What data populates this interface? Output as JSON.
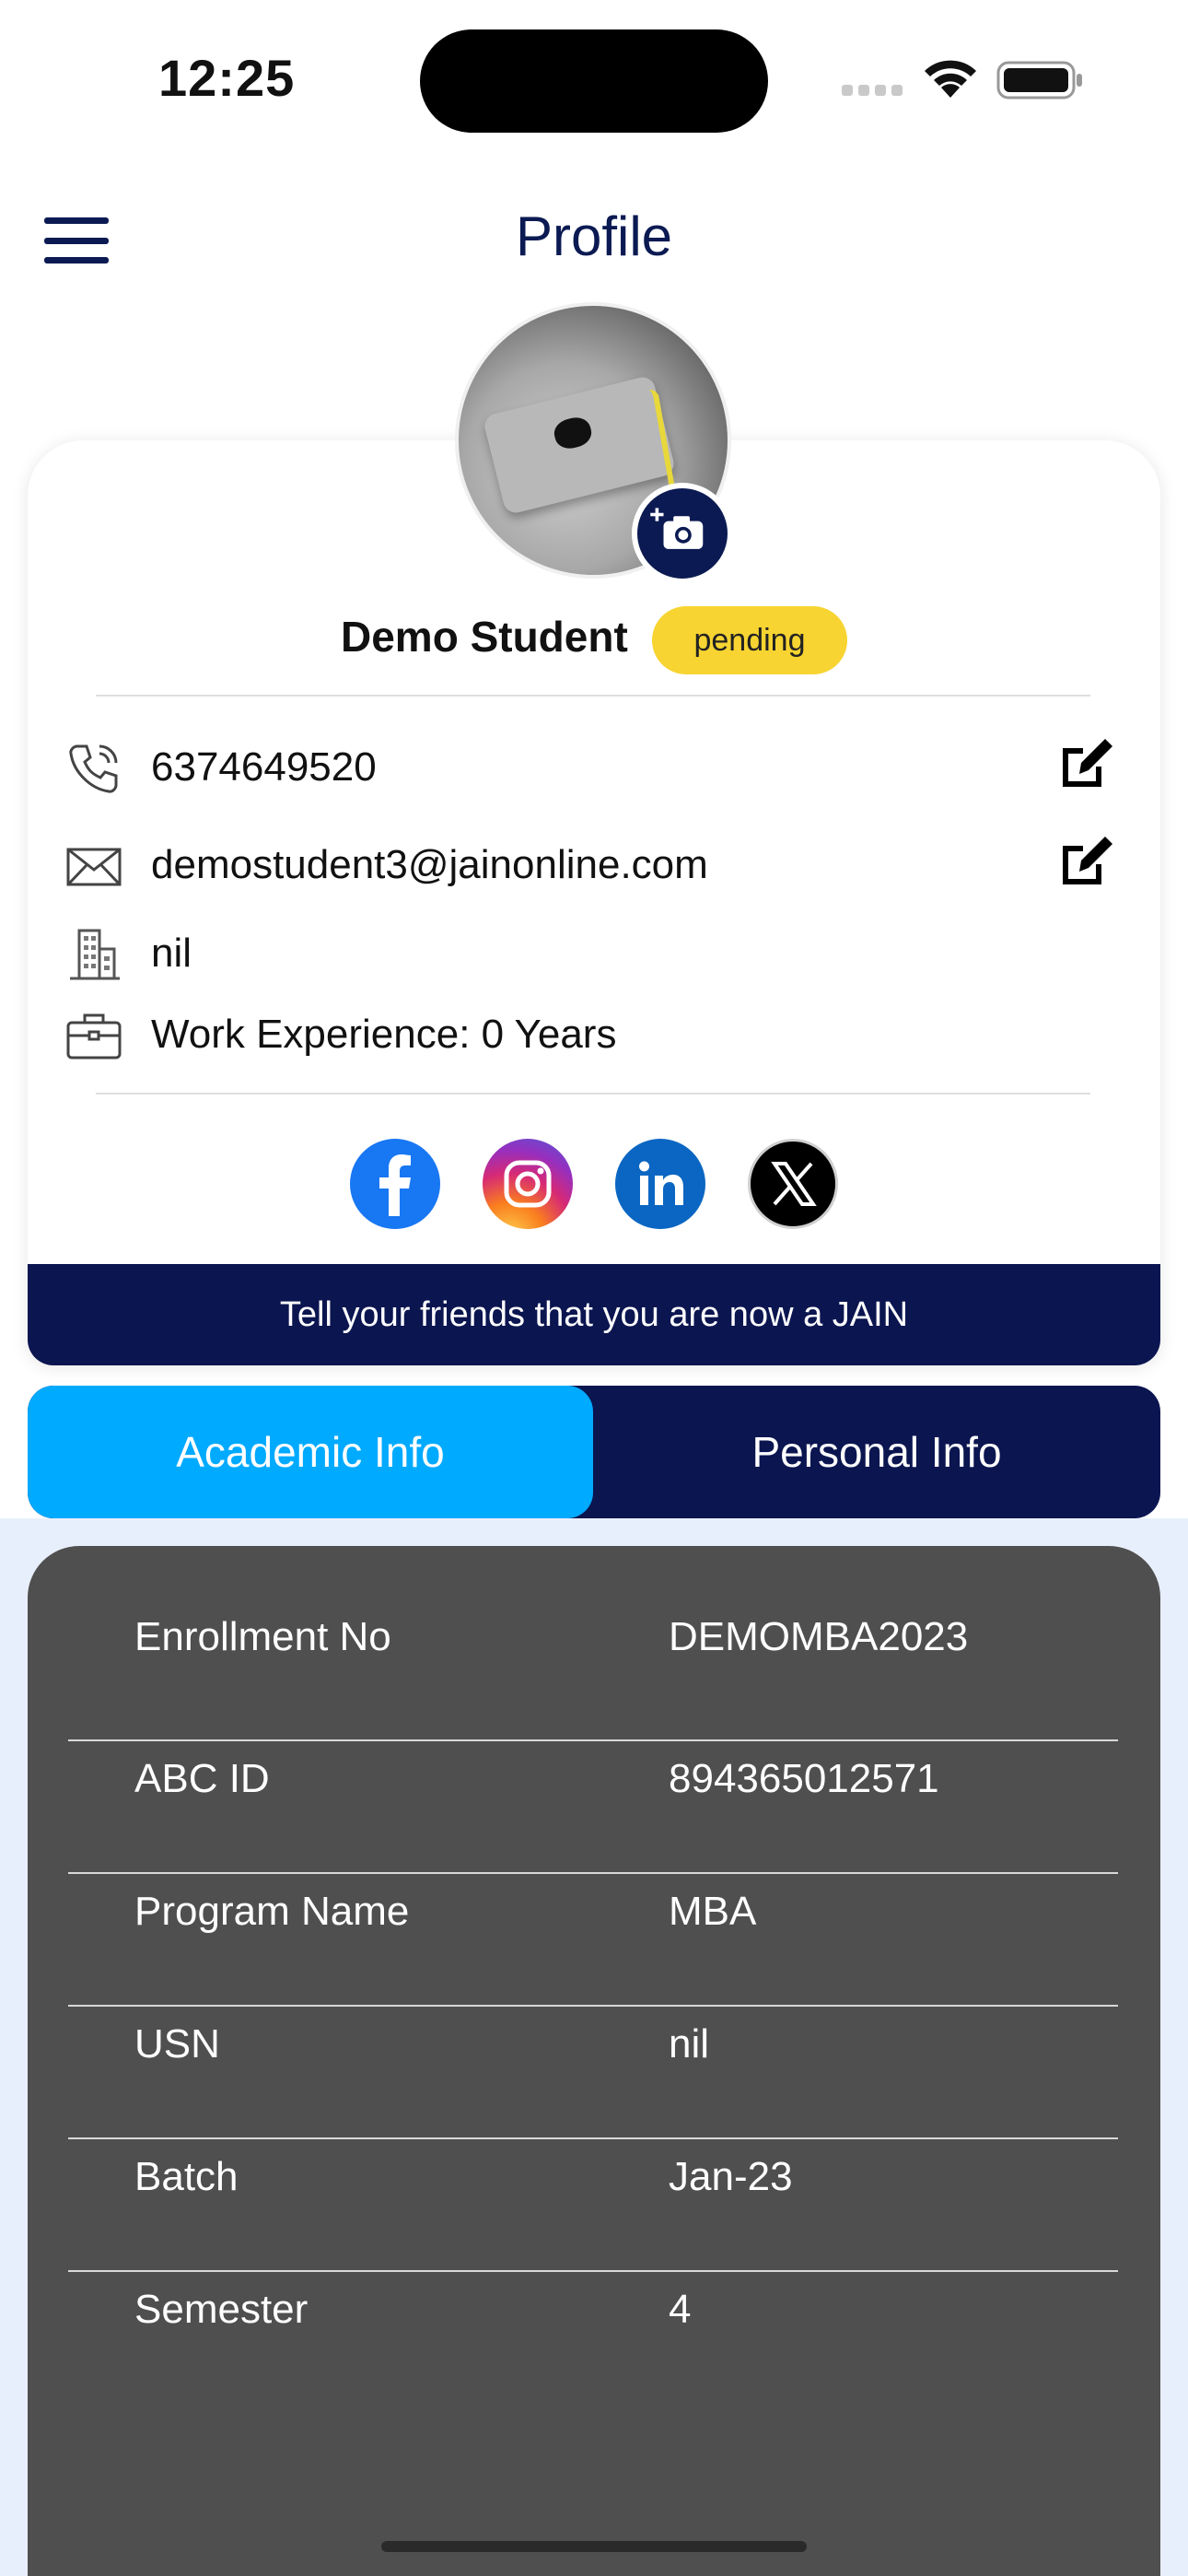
{
  "status_bar": {
    "time": "12:25"
  },
  "header": {
    "title": "Profile",
    "menu_icon": "hamburger-menu-icon"
  },
  "profile": {
    "name": "Demo Student",
    "status": "pending",
    "phone": "6374649520",
    "email": "demostudent3@jainonline.com",
    "organization": "nil",
    "work_experience": "Work Experience: 0 Years"
  },
  "socials": [
    "facebook-icon",
    "instagram-icon",
    "linkedin-icon",
    "x-icon"
  ],
  "share_banner": "Tell your friends that you are now a JAIN",
  "tabs": [
    {
      "label": "Academic Info",
      "active": true
    },
    {
      "label": "Personal Info",
      "active": false
    }
  ],
  "academic_info": [
    {
      "label": "Enrollment No",
      "value": "DEMOMBA2023"
    },
    {
      "label": "ABC ID",
      "value": "894365012571"
    },
    {
      "label": "Program Name",
      "value": "MBA"
    },
    {
      "label": "USN",
      "value": "nil"
    },
    {
      "label": "Batch",
      "value": "Jan-23"
    },
    {
      "label": "Semester",
      "value": "4"
    }
  ],
  "colors": {
    "navy": "#0b1550",
    "accent_blue": "#00aaff",
    "badge_yellow": "#f7d431",
    "card_dark": "#4f4f4f",
    "lower_bg": "#e8effc"
  }
}
